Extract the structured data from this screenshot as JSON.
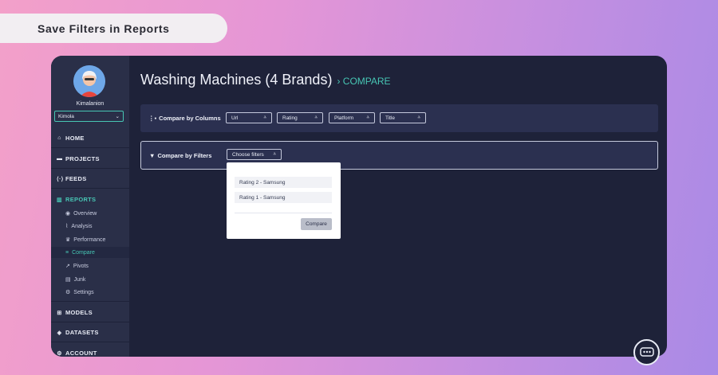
{
  "banner": {
    "title": "Save Filters in Reports"
  },
  "sidebar": {
    "username": "Kimalanion",
    "workspace_select": "Kimola",
    "nav": [
      {
        "label": "HOME",
        "icon": "home-icon"
      },
      {
        "label": "PROJECTS",
        "icon": "folder-icon"
      },
      {
        "label": "FEEDS",
        "icon": "feed-icon"
      },
      {
        "label": "REPORTS",
        "icon": "bar-chart-icon",
        "active": true
      }
    ],
    "report_items": [
      {
        "label": "Overview",
        "icon": "eye-icon"
      },
      {
        "label": "Analysis",
        "icon": "analysis-icon"
      },
      {
        "label": "Performance",
        "icon": "trophy-icon"
      },
      {
        "label": "Compare",
        "icon": "compare-icon",
        "active": true
      },
      {
        "label": "Pivots",
        "icon": "pivot-icon"
      },
      {
        "label": "Junk",
        "icon": "trash-icon"
      },
      {
        "label": "Settings",
        "icon": "gear-icon"
      }
    ],
    "nav_bottom": [
      {
        "label": "MODELS",
        "icon": "models-icon"
      },
      {
        "label": "DATASETS",
        "icon": "datasets-icon"
      },
      {
        "label": "ACCOUNT",
        "icon": "account-icon"
      }
    ]
  },
  "main": {
    "title": "Washing Machines (4 Brands)",
    "breadcrumb": "COMPARE",
    "columns_label": "Compare by Columns",
    "columns": [
      "Url",
      "Rating",
      "Platform",
      "Title"
    ],
    "filters_label": "Compare by Filters",
    "filters_dropdown": "Choose filters",
    "dropdown_options": [
      "Rating 2 - Samsung",
      "Rating 1 - Samsung"
    ],
    "compare_button": "Compare"
  },
  "colors": {
    "accent": "#47c6b4",
    "app_bg": "#1e2239",
    "sidebar_bg": "#2a2f48"
  }
}
